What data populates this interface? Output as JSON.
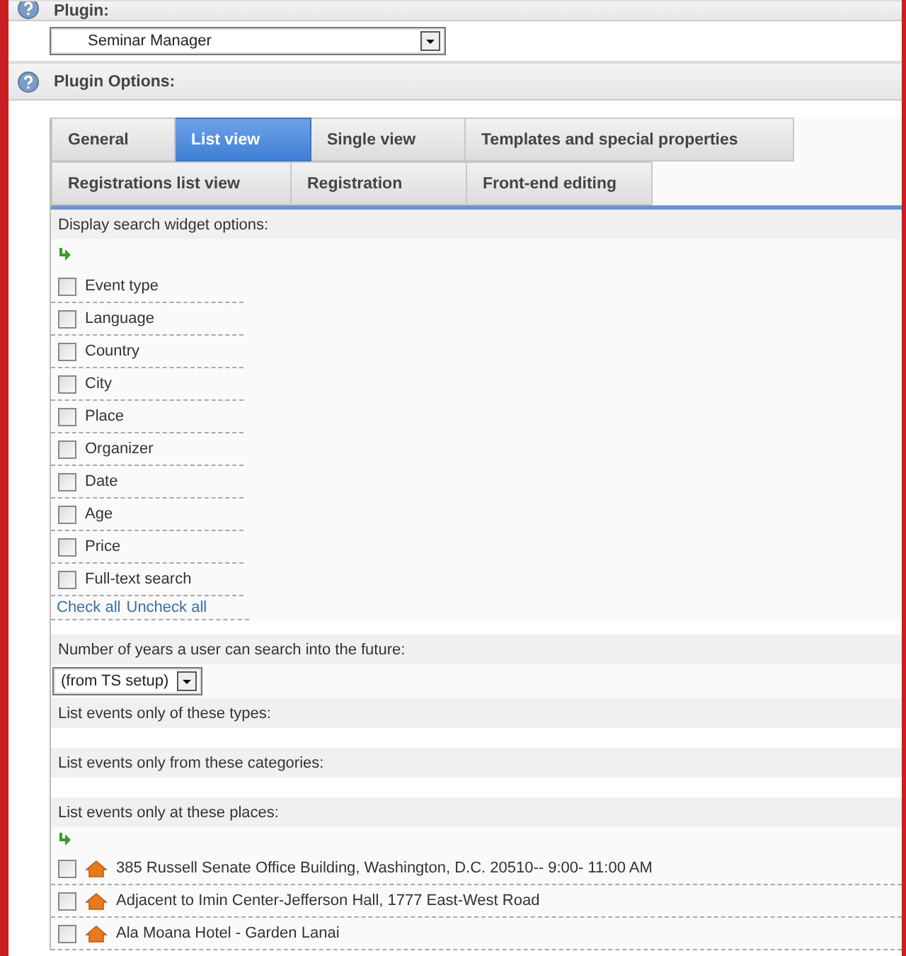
{
  "plugin_section": {
    "title": "Plugin:",
    "select": {
      "value": "Seminar Manager"
    }
  },
  "options_section": {
    "title": "Plugin Options:"
  },
  "tabs": [
    {
      "label": "General",
      "selected": false
    },
    {
      "label": "List view",
      "selected": true
    },
    {
      "label": "Single view",
      "selected": false
    },
    {
      "label": "Templates and special properties",
      "selected": false
    },
    {
      "label": "Registrations list view",
      "selected": false
    },
    {
      "label": "Registration",
      "selected": false
    },
    {
      "label": "Front-end editing",
      "selected": false
    }
  ],
  "search_widget": {
    "label": "Display search widget options:",
    "options": [
      {
        "label": "Event type",
        "checked": false
      },
      {
        "label": "Language",
        "checked": false
      },
      {
        "label": "Country",
        "checked": false
      },
      {
        "label": "City",
        "checked": false
      },
      {
        "label": "Place",
        "checked": false
      },
      {
        "label": "Organizer",
        "checked": false
      },
      {
        "label": "Date",
        "checked": false
      },
      {
        "label": "Age",
        "checked": false
      },
      {
        "label": "Price",
        "checked": false
      },
      {
        "label": "Full-text search",
        "checked": false
      }
    ],
    "links": [
      "Check all",
      "Uncheck all"
    ]
  },
  "years": {
    "label": "Number of years a user can search into the future:",
    "select": {
      "value": "(from TS setup)"
    }
  },
  "types": {
    "label": "List events only of these types:"
  },
  "categories": {
    "label": "List events only from these categories:"
  },
  "places": {
    "label": "List events only at these places:",
    "items": [
      {
        "label": "385 Russell Senate Office Building, Washington, D.C. 20510-- 9:00- 11:00 AM",
        "checked": false
      },
      {
        "label": "Adjacent to Imin Center-Jefferson Hall, 1777 East-West Road",
        "checked": false
      },
      {
        "label": "Ala Moana Hotel - Garden Lanai",
        "checked": false
      }
    ]
  }
}
